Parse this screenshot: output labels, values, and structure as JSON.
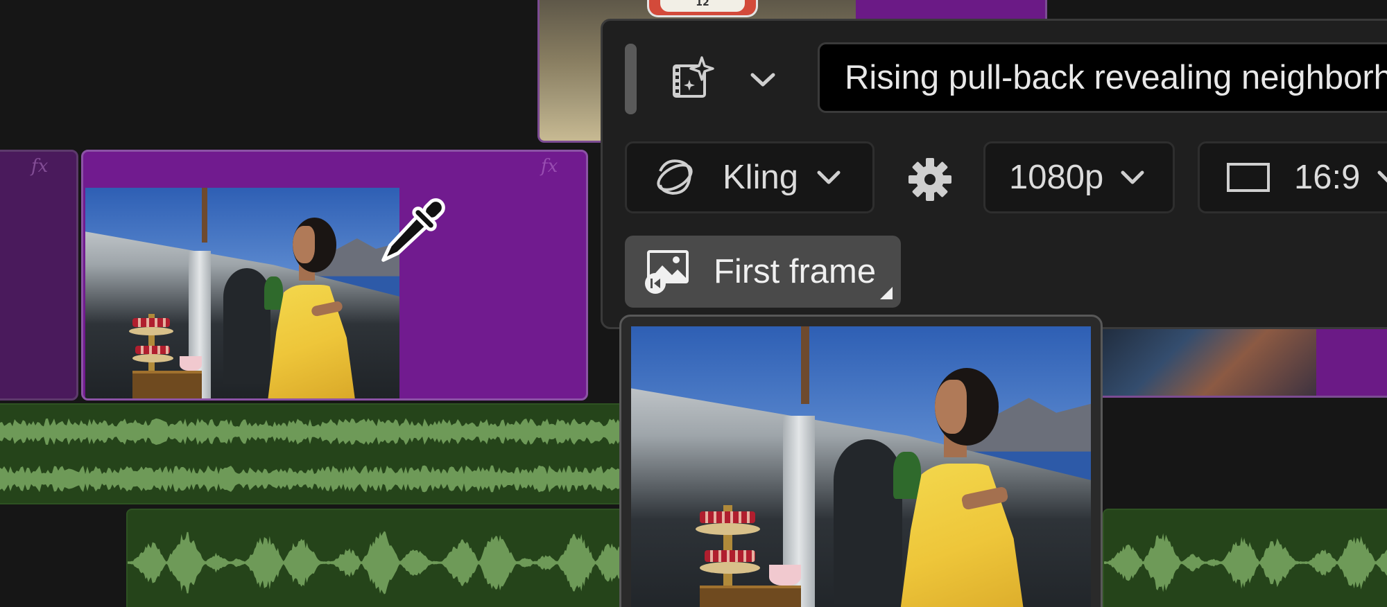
{
  "top_clip": {
    "clock_label": "12"
  },
  "main_clip": {
    "fx_label": "fx"
  },
  "left_clip": {
    "fx_label": "fx"
  },
  "generation_panel": {
    "prompt_text": "Rising pull-back revealing neighborhood",
    "model": {
      "label": "Kling",
      "icon": "kling-logo-icon"
    },
    "resolution": {
      "label": "1080p"
    },
    "aspect_ratio": {
      "label": "16:9",
      "icon": "rectangle-icon"
    },
    "settings_icon": "gear-icon",
    "generator_icon": "ai-video-sparkle-icon",
    "first_frame": {
      "label": "First frame",
      "icon": "image-first-frame-icon"
    }
  },
  "colors": {
    "background": "#161616",
    "clip_purple": "#711b8f",
    "audio_green": "#25441a",
    "waveform": "#6e9a58",
    "panel_bg": "#1f1f1f",
    "first_frame_bg": "#4a4a4a"
  }
}
